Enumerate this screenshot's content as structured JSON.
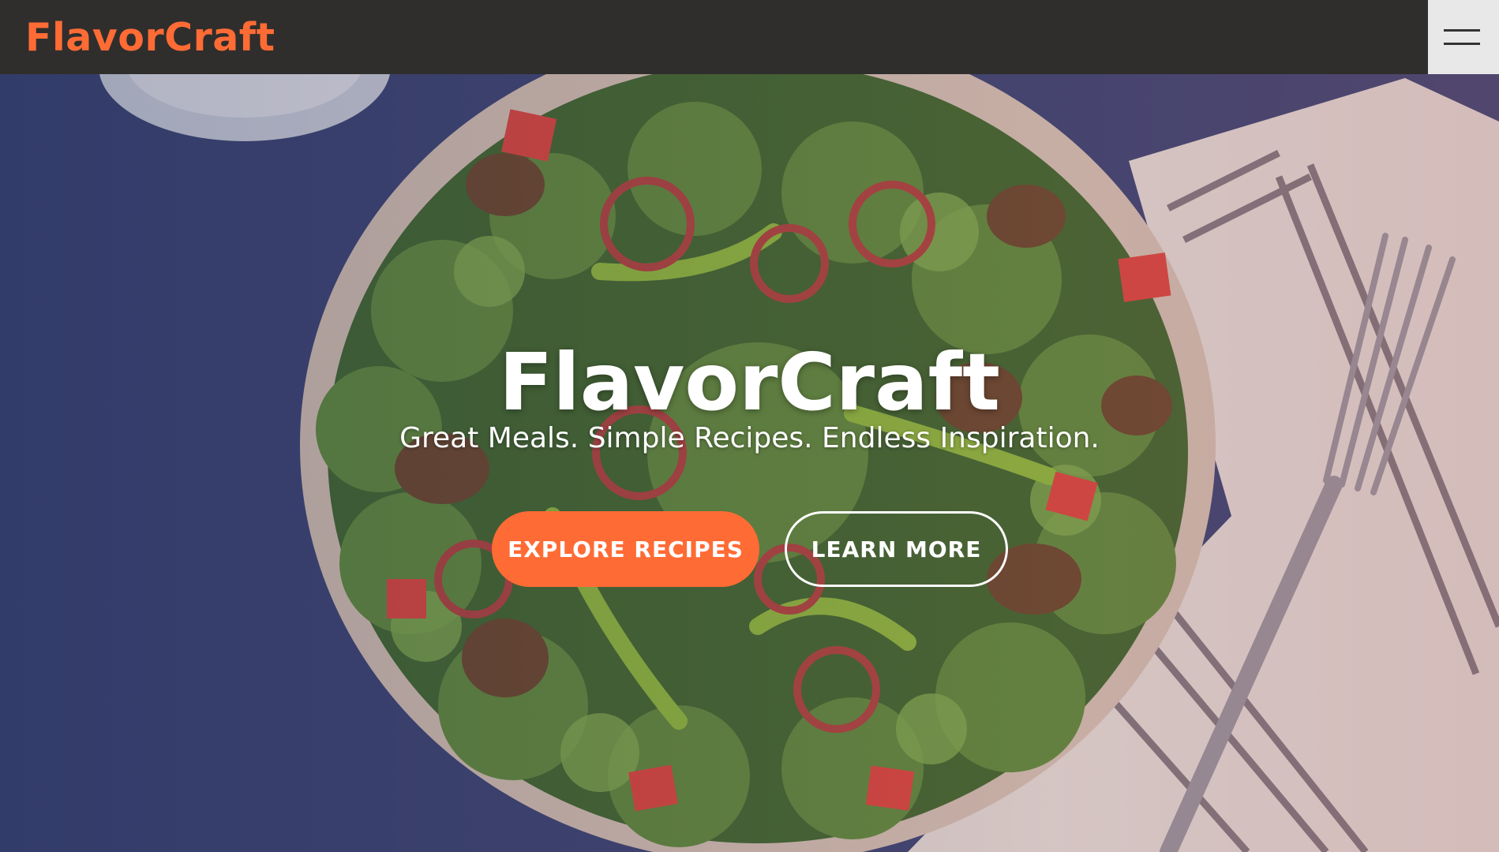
{
  "header": {
    "brand": "FlavorCraft",
    "menu_icon": "hamburger-icon"
  },
  "hero": {
    "title": "FlavorCraft",
    "subtitle": "Great Meals. Simple Recipes. Endless Inspiration.",
    "primary_button": "EXPLORE RECIPES",
    "secondary_button": "LEARN MORE"
  },
  "colors": {
    "accent": "#ff6b35",
    "header_bg": "#2f2e2c",
    "menu_bg": "#e8e8e8",
    "text_light": "#ffffff"
  }
}
